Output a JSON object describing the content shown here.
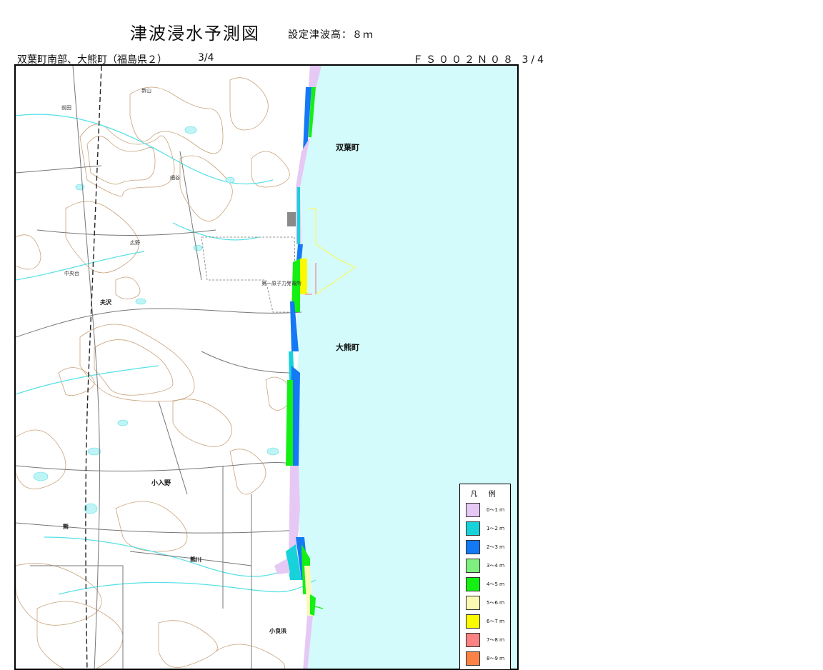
{
  "header": {
    "title": "津波浸水予測図",
    "subtitle": "設定津波高：８ｍ",
    "area_name": "双葉町南部、大熊町（福島県２）",
    "area_page": "3/4",
    "sheet_code": "ＦＳ００２Ｎ０８ 3/4"
  },
  "map": {
    "towns": [
      "双葉町",
      "大熊町"
    ],
    "places": {
      "nishiyama": "新山",
      "maeda": "前田",
      "hososaya": "細谷",
      "otto": "夫沢",
      "koiri": "小入野",
      "kuma": "熊",
      "kumakawa": "熊川",
      "onami": "小良浜",
      "plant": "第一原子力発電所",
      "hiro": "広野",
      "nakanodai": "中央台"
    },
    "colors": {
      "sea": "#d3fbfc",
      "contour": "#c8a27a",
      "river": "#55e0e6",
      "road": "#777777"
    }
  },
  "legend": {
    "title": "凡 例",
    "items": [
      {
        "label": "0～1 ｍ",
        "color": "#e6c8f5"
      },
      {
        "label": "1～2 ｍ",
        "color": "#17d3d9"
      },
      {
        "label": "2～3 ｍ",
        "color": "#1479f5"
      },
      {
        "label": "3～4 ｍ",
        "color": "#7ff07f"
      },
      {
        "label": "4～5 ｍ",
        "color": "#14f014"
      },
      {
        "label": "5～6 ｍ",
        "color": "#fafab4"
      },
      {
        "label": "6～7 ｍ",
        "color": "#fafa00"
      },
      {
        "label": "7～8 ｍ",
        "color": "#fa8282"
      },
      {
        "label": "8～9 ｍ",
        "color": "#fa8246"
      }
    ]
  }
}
